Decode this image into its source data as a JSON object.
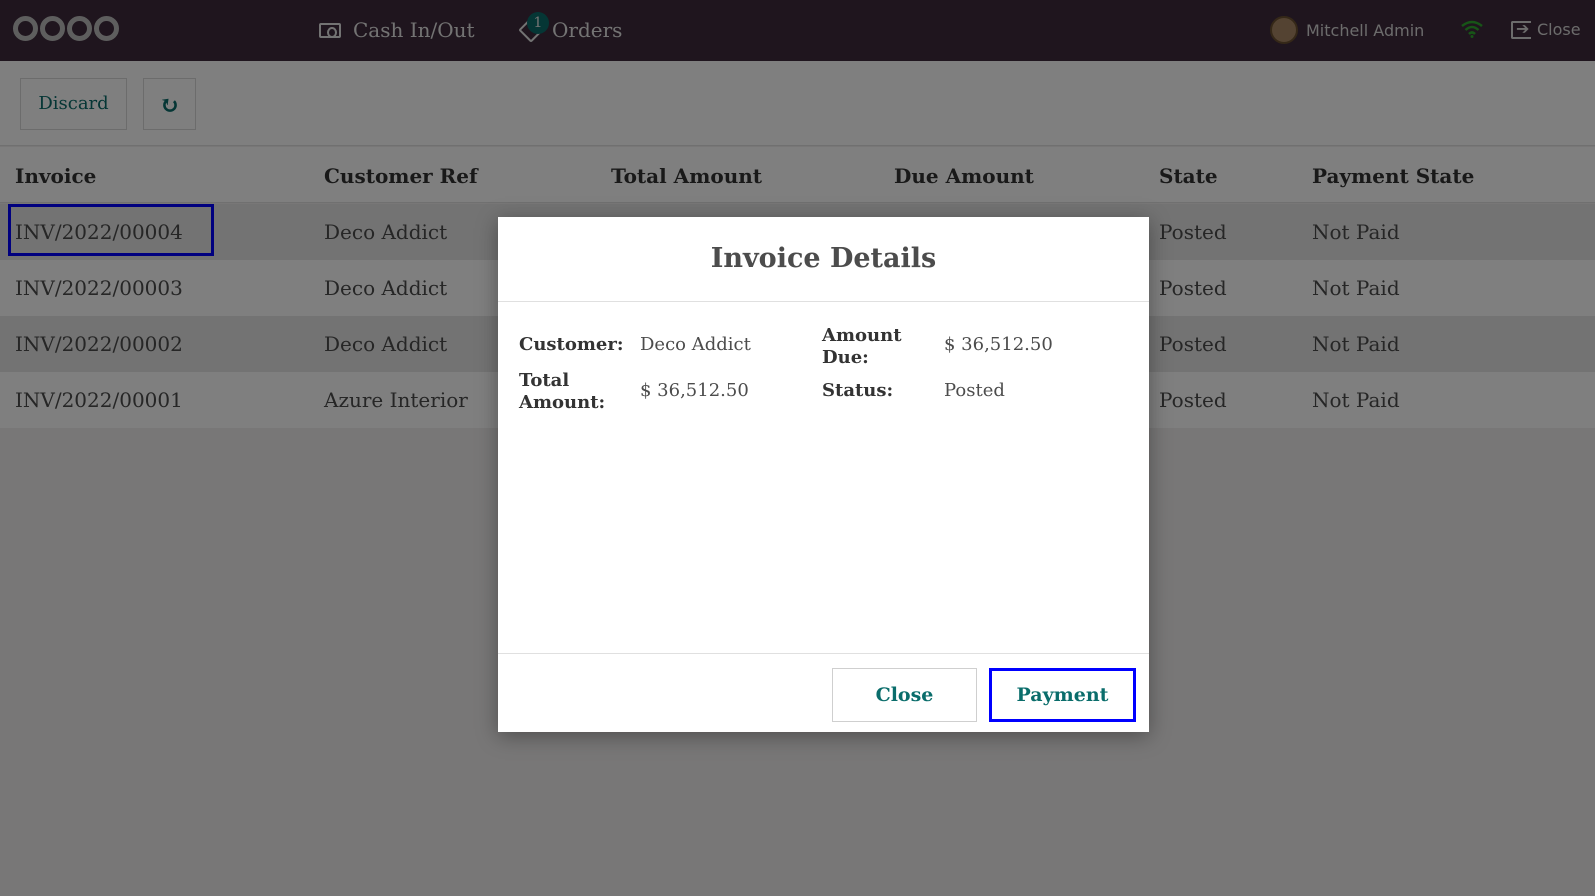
{
  "navbar": {
    "cash_label": "Cash In/Out",
    "orders_label": "Orders",
    "orders_badge": "1",
    "user_name": "Mitchell Admin",
    "close_label": "Close"
  },
  "controls": {
    "discard_label": "Discard",
    "refresh_icon": "↻"
  },
  "table": {
    "headers": [
      "Invoice",
      "Customer Ref",
      "Total Amount",
      "Due Amount",
      "State",
      "Payment State"
    ],
    "rows": [
      {
        "invoice": "INV/2022/00004",
        "customer": "Deco Addict",
        "state": "Posted",
        "payment_state": "Not Paid"
      },
      {
        "invoice": "INV/2022/00003",
        "customer": "Deco Addict",
        "state": "Posted",
        "payment_state": "Not Paid"
      },
      {
        "invoice": "INV/2022/00002",
        "customer": "Deco Addict",
        "state": "Posted",
        "payment_state": "Not Paid"
      },
      {
        "invoice": "INV/2022/00001",
        "customer": "Azure Interior",
        "state": "Posted",
        "payment_state": "Not Paid"
      }
    ]
  },
  "modal": {
    "title": "Invoice Details",
    "customer_label": "Customer:",
    "customer_value": "Deco Addict",
    "total_label": "Total Amount:",
    "total_value": "$ 36,512.50",
    "due_label": "Amount Due:",
    "due_value": "$ 36,512.50",
    "status_label": "Status:",
    "status_value": "Posted",
    "close_label": "Close",
    "payment_label": "Payment"
  }
}
